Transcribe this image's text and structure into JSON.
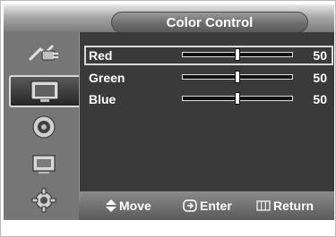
{
  "menu": {
    "title": "Color Control"
  },
  "sidebar": {
    "items": [
      {
        "icon": "antenna-plug-icon"
      },
      {
        "icon": "tv-picture-icon",
        "active": true
      },
      {
        "icon": "speaker-sound-icon"
      },
      {
        "icon": "screen-settings-icon"
      },
      {
        "icon": "gear-setup-icon"
      }
    ]
  },
  "controls": [
    {
      "label": "Red",
      "value": "50",
      "level": 0.5
    },
    {
      "label": "Green",
      "value": "50",
      "level": 0.5
    },
    {
      "label": "Blue",
      "value": "50",
      "level": 0.5
    }
  ],
  "footer": {
    "move": "Move",
    "enter": "Enter",
    "return": "Return"
  },
  "colors": {
    "panel": "#8a8a8a",
    "content": "#3a3a3a",
    "text": "#ffffff"
  }
}
